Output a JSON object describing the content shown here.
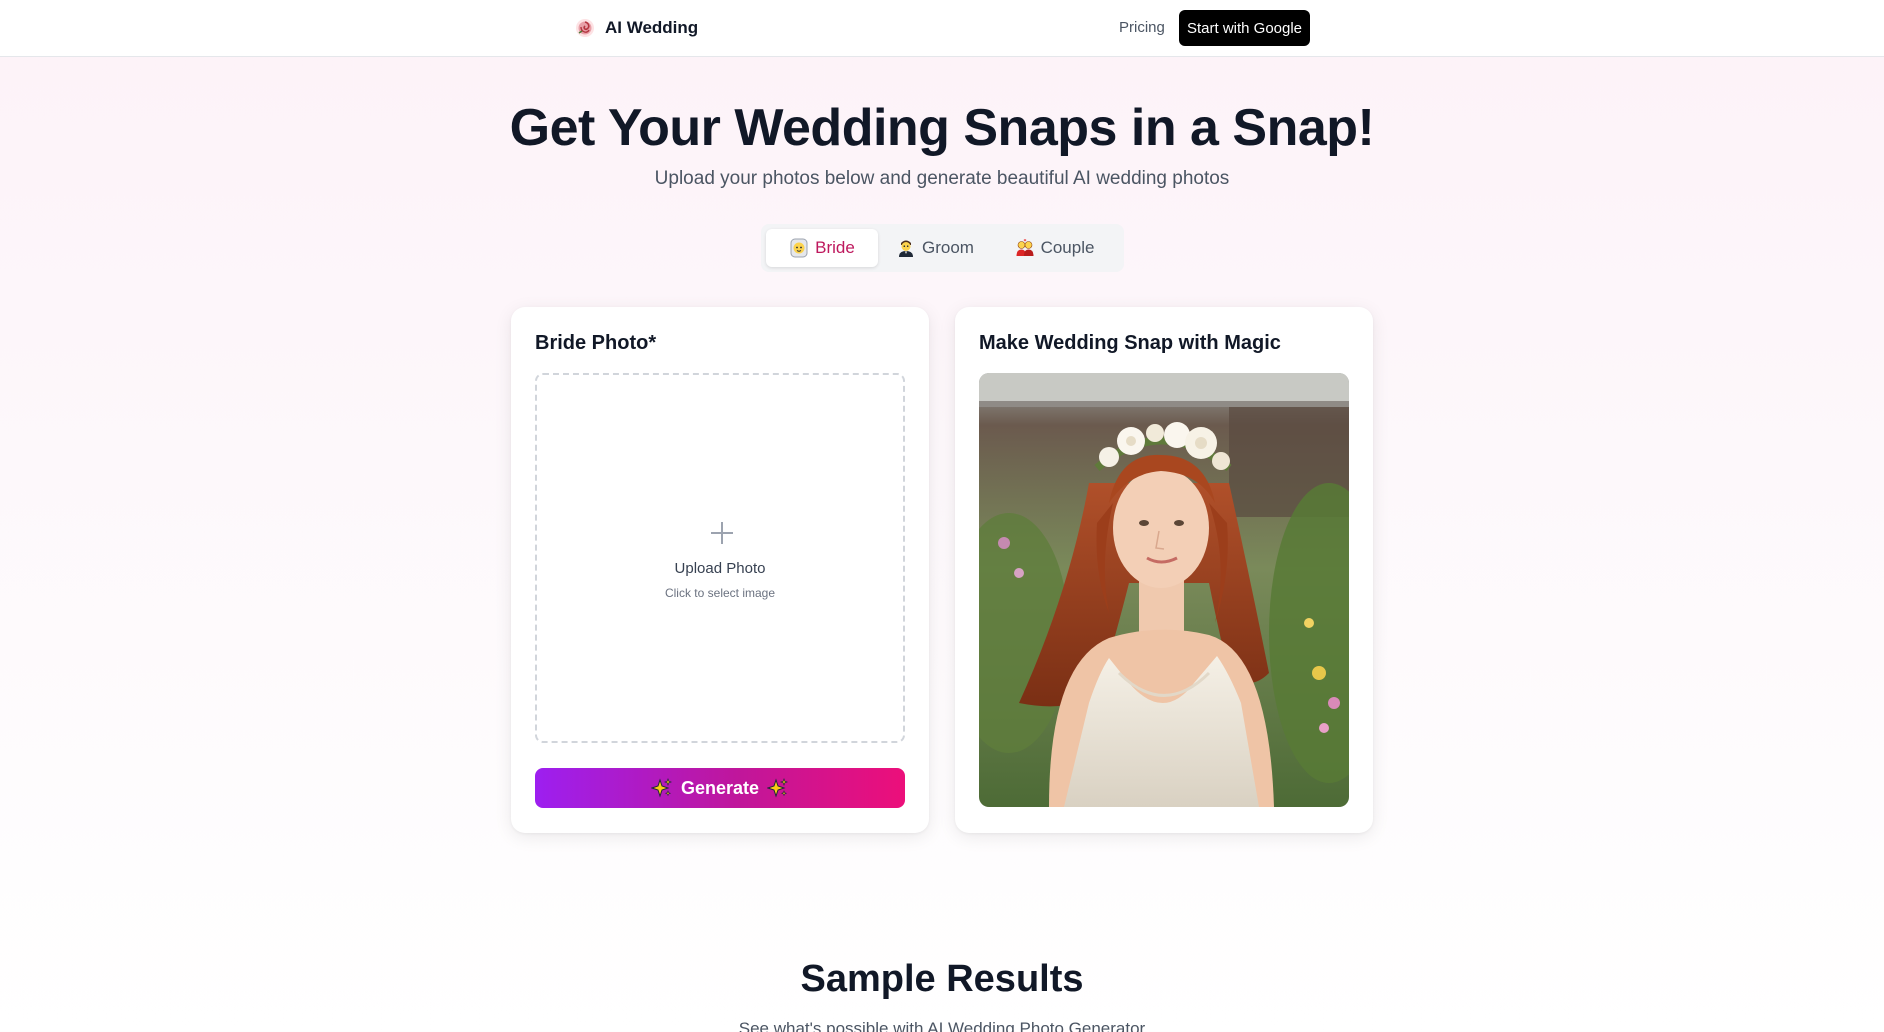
{
  "header": {
    "brand_name": "AI Wedding",
    "logo_icon": "rose-logo-icon",
    "nav_pricing": "Pricing",
    "cta_label": "Start with Google"
  },
  "hero": {
    "title": "Get Your Wedding Snaps in a Snap!",
    "subtitle": "Upload your photos below and generate beautiful AI wedding photos"
  },
  "tabs": [
    {
      "label": "Bride",
      "icon": "bride-emoji-icon",
      "active": true
    },
    {
      "label": "Groom",
      "icon": "groom-emoji-icon",
      "active": false
    },
    {
      "label": "Couple",
      "icon": "couple-emoji-icon",
      "active": false
    }
  ],
  "upload_card": {
    "title": "Bride Photo*",
    "upload_label": "Upload Photo",
    "upload_hint": "Click to select image",
    "generate_label": "Generate"
  },
  "preview_card": {
    "title": "Make Wedding Snap with Magic",
    "image": "bride-sample-photo"
  },
  "samples": {
    "title": "Sample Results",
    "subtitle": "See what's possible with AI Wedding Photo Generator"
  },
  "colors": {
    "accent_pink": "#be185d",
    "gradient_start": "#9d1ff0",
    "gradient_end": "#ec0f7a",
    "cta_bg": "#000000"
  }
}
